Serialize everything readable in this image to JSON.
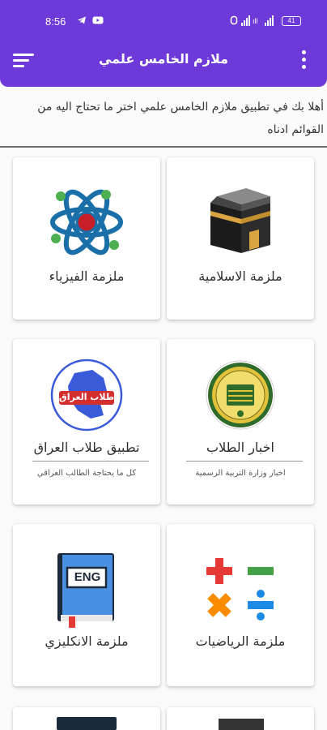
{
  "status_bar": {
    "time": "8:56",
    "battery": "41"
  },
  "app_bar": {
    "title": "ملازم الخامس علمي"
  },
  "welcome": {
    "text": "أهلا بك في تطبيق ملازم الخامس علمي اختر ما تحتاج اليه من القوائم ادناه"
  },
  "cards": {
    "islamic": {
      "label": "ملزمة الاسلامية"
    },
    "physics": {
      "label": "ملزمة الفيزياء"
    },
    "news": {
      "label": "اخبار الطلاب",
      "subtitle": "اخبار وزارة التربية الرسمية"
    },
    "iraq_app": {
      "label": "تطبيق طلاب العراق",
      "subtitle": "كل ما يحتاجة الطالب العراقي",
      "logo_text": "طلاب العراق"
    },
    "math": {
      "label": "ملزمة الرياضيات"
    },
    "english": {
      "label": "ملزمة الانكليزي",
      "book_text": "ENG"
    }
  },
  "colors": {
    "primary": "#6d3ad9",
    "atom": "#1b6fa8",
    "atom_core": "#c81e28",
    "atom_electron": "#4caf50",
    "kaaba_gold": "#d9a441",
    "math_red": "#e53935",
    "math_green": "#43a047",
    "math_orange": "#fb8c00",
    "math_blue": "#1e88e5",
    "book_blue": "#4a90e2"
  }
}
